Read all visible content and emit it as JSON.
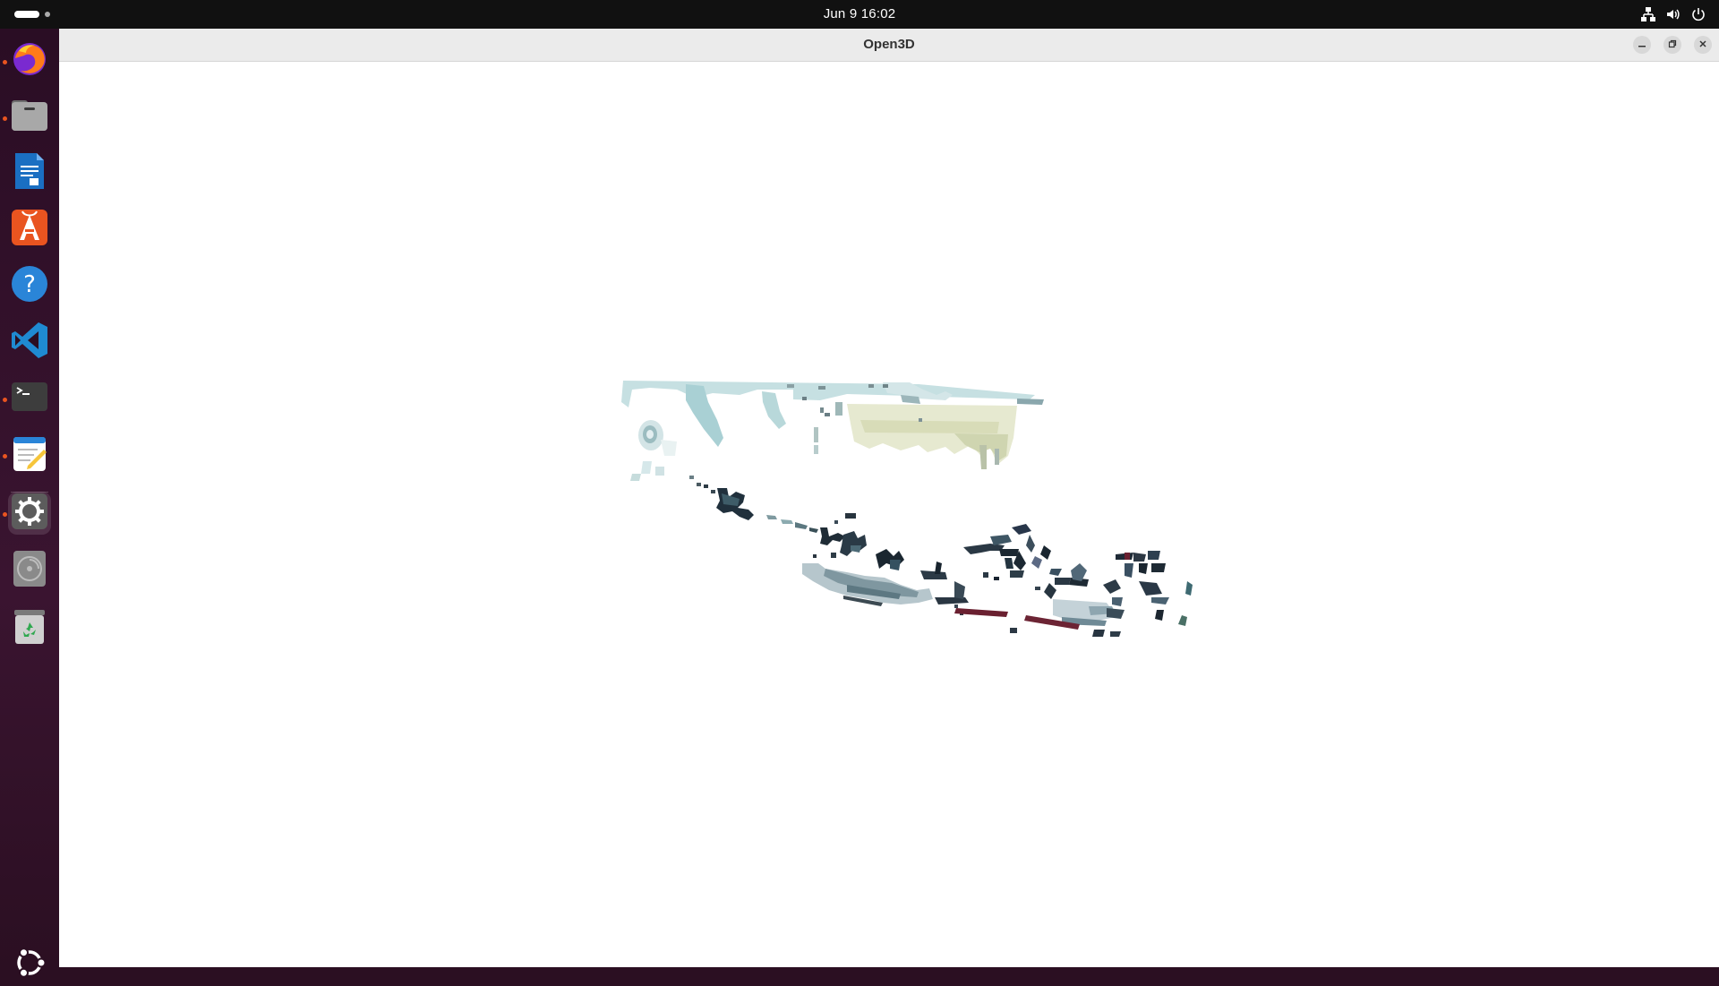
{
  "topbar": {
    "clock": "Jun 9  16:02",
    "tray_icons": [
      "network-icon",
      "volume-icon",
      "power-icon"
    ]
  },
  "dock": {
    "items": [
      {
        "name": "firefox",
        "icon": "firefox-icon",
        "running": true
      },
      {
        "name": "files",
        "icon": "files-icon",
        "running": true
      },
      {
        "name": "libreoffice-writer",
        "icon": "writer-icon",
        "running": false
      },
      {
        "name": "app-center",
        "icon": "app-center-icon",
        "running": false
      },
      {
        "name": "help",
        "icon": "help-icon",
        "running": false
      },
      {
        "name": "vscode",
        "icon": "vscode-icon",
        "running": false
      },
      {
        "name": "terminal",
        "icon": "terminal-icon",
        "running": true
      },
      {
        "name": "text-editor",
        "icon": "text-editor-icon",
        "running": true
      },
      {
        "name": "settings",
        "icon": "settings-icon",
        "running": true,
        "active": true
      },
      {
        "name": "disc",
        "icon": "optical-drive-icon",
        "running": false
      },
      {
        "name": "trash",
        "icon": "trash-icon",
        "running": false
      }
    ],
    "show_apps_icon": "ubuntu-logo-icon"
  },
  "window": {
    "title": "Open3D",
    "controls": [
      "minimize-icon",
      "maximize-icon",
      "close-icon"
    ]
  },
  "colors": {
    "topbar": "#111111",
    "dock": "#2b0f22",
    "accent": "#e95420",
    "viewport_bg": "#ffffff"
  }
}
